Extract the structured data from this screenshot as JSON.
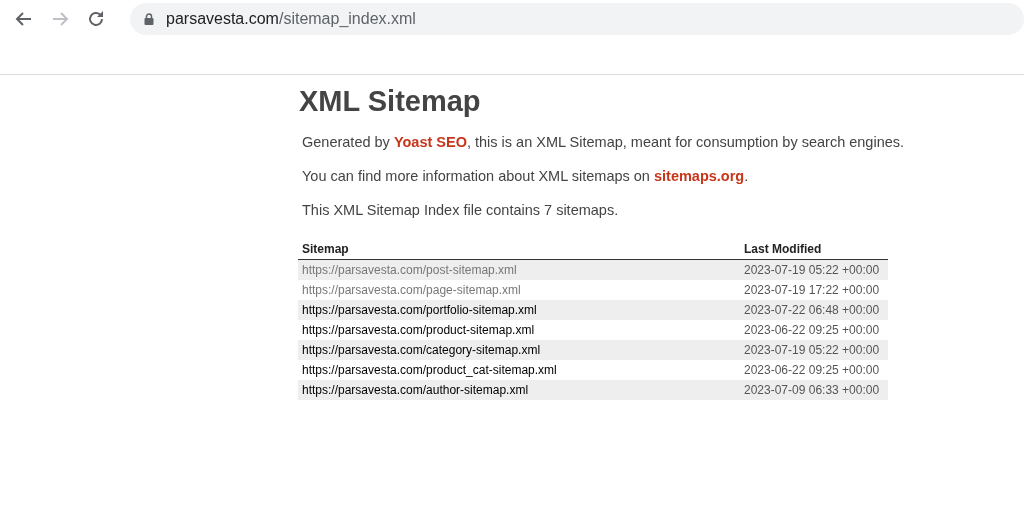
{
  "browser": {
    "back": {
      "disabled": false
    },
    "forward": {
      "disabled": true
    },
    "address": {
      "host": "parsavesta.com",
      "path": "/sitemap_index.xml"
    }
  },
  "page": {
    "title": "XML Sitemap",
    "paragraphs": [
      {
        "before": "Generated by ",
        "link": "Yoast SEO",
        "after": ", this is an XML Sitemap, meant for consumption by search engines."
      },
      {
        "before": "You can find more information about XML sitemaps on ",
        "link": "sitemaps.org",
        "after": "."
      },
      {
        "before": "This XML Sitemap Index file contains 7 sitemaps."
      }
    ],
    "table": {
      "columns": [
        "Sitemap",
        "Last Modified"
      ],
      "rows": [
        {
          "url": "https://parsavesta.com/post-sitemap.xml",
          "modified": "2023-07-19 05:22 +00:00",
          "visited": true
        },
        {
          "url": "https://parsavesta.com/page-sitemap.xml",
          "modified": "2023-07-19 17:22 +00:00",
          "visited": true
        },
        {
          "url": "https://parsavesta.com/portfolio-sitemap.xml",
          "modified": "2023-07-22 06:48 +00:00",
          "visited": false
        },
        {
          "url": "https://parsavesta.com/product-sitemap.xml",
          "modified": "2023-06-22 09:25 +00:00",
          "visited": false
        },
        {
          "url": "https://parsavesta.com/category-sitemap.xml",
          "modified": "2023-07-19 05:22 +00:00",
          "visited": false
        },
        {
          "url": "https://parsavesta.com/product_cat-sitemap.xml",
          "modified": "2023-06-22 09:25 +00:00",
          "visited": false
        },
        {
          "url": "https://parsavesta.com/author-sitemap.xml",
          "modified": "2023-07-09 06:33 +00:00",
          "visited": false
        }
      ]
    }
  }
}
